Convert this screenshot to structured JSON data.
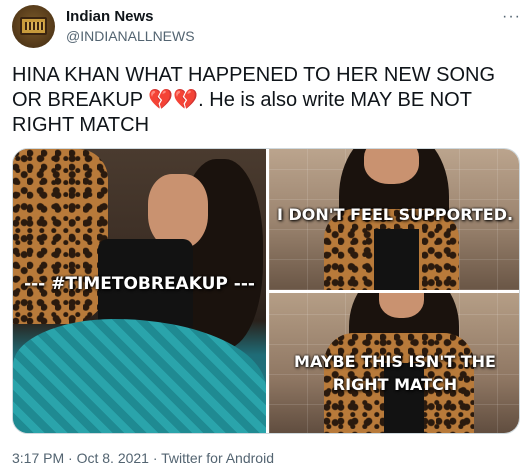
{
  "account": {
    "name": "Indian News",
    "handle": "@INDIANALLNEWS",
    "more_icon": "more-horizontal-icon"
  },
  "tweet": {
    "text_line1": "HINA KHAN WHAT HAPPENED TO HER NEW SONG",
    "text_line2_before": "OR BREAKUP ",
    "hearts": "💔💔",
    "text_line2_after": ". He is also write MAY BE NOT",
    "text_line3": "RIGHT MATCH"
  },
  "media": {
    "left_caption": "--- #TIMETOBREAKUP ---",
    "top_right_caption": "I DON'T FEEL SUPPORTED.",
    "bottom_right_caption_line1": "MAYBE THIS ISN'T THE",
    "bottom_right_caption_line2": "RIGHT MATCH"
  },
  "meta": {
    "timestamp": "3:17 PM · Oct 8, 2021 · Twitter for Android"
  }
}
